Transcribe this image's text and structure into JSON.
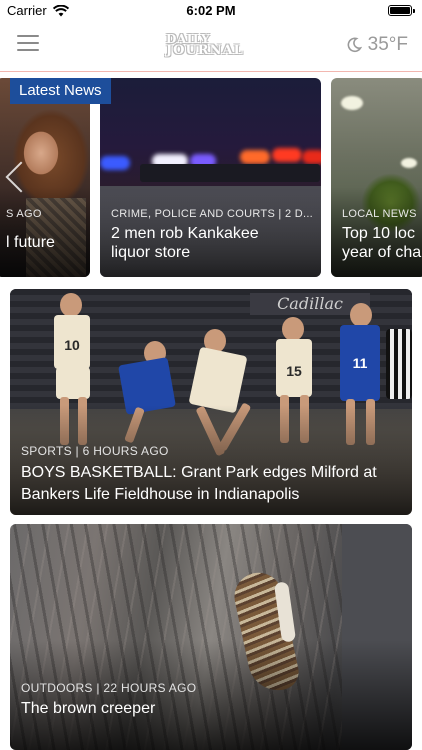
{
  "status_bar": {
    "carrier": "Carrier",
    "time": "6:02 PM"
  },
  "nav": {
    "logo_line1": "DAILY",
    "logo_line2": "JOURNAL",
    "temperature": "35°F"
  },
  "carousel": {
    "badge": "Latest News",
    "cards": [
      {
        "meta": "S AGO",
        "title": "l future"
      },
      {
        "meta": "CRIME, POLICE AND COURTS | 2 D...",
        "title_line1": "2 men rob Kankakee",
        "title_line2": "liquor store"
      },
      {
        "meta": "LOCAL NEWS",
        "title_line1": "Top 10 loc",
        "title_line2": "year of cha"
      }
    ]
  },
  "feed": [
    {
      "meta": "SPORTS | 6 HOURS AGO",
      "title": "BOYS BASKETBALL: Grant Park edges Milford at Bankers Life Fieldhouse in Indianapolis",
      "banner": "Cadillac",
      "jerseys": [
        "10",
        "",
        "15",
        "11"
      ]
    },
    {
      "meta": "OUTDOORS | 22 HOURS AGO",
      "title": "The brown creeper"
    }
  ],
  "colors": {
    "badge_bg": "#1d4e9b",
    "nav_divider": "#f2b7b0",
    "weather_text": "#9a9a9a"
  },
  "icons": {
    "menu": "menu-icon",
    "weather": "moon-icon",
    "wifi": "wifi-icon",
    "battery": "battery-icon",
    "carousel_prev": "chevron-left-icon"
  }
}
